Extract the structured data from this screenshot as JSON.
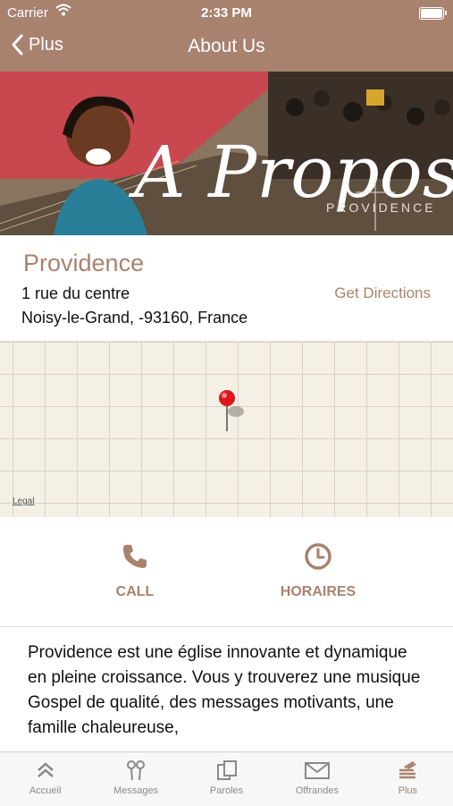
{
  "status_bar": {
    "carrier": "Carrier",
    "time": "2:33 PM"
  },
  "nav": {
    "back_label": "Plus",
    "title": "About Us"
  },
  "banner": {
    "script_text": "A Propos",
    "brand": "PROVIDENCE"
  },
  "location": {
    "name": "Providence",
    "address_line1": "1 rue du centre",
    "address_line2": "Noisy-le-Grand,  -93160, France",
    "directions_label": "Get Directions"
  },
  "map": {
    "legal_label": "Legal"
  },
  "actions": {
    "call_label": "CALL",
    "hours_label": "HORAIRES"
  },
  "description": "Providence est une église innovante et dynamique en pleine croissance. Vous y trouverez une musique Gospel de qualité, des messages motivants, une famille chaleureuse,",
  "tabs": [
    {
      "label": "Accueil",
      "icon": "chevrons-up-icon"
    },
    {
      "label": "Messages",
      "icon": "microphones-icon"
    },
    {
      "label": "Paroles",
      "icon": "pages-icon"
    },
    {
      "label": "Offrandes",
      "icon": "envelope-icon"
    },
    {
      "label": "Plus",
      "icon": "stack-icon"
    }
  ],
  "colors": {
    "accent": "#a9826f",
    "map_background": "#f4f0e6",
    "pin": "#e0141c"
  }
}
